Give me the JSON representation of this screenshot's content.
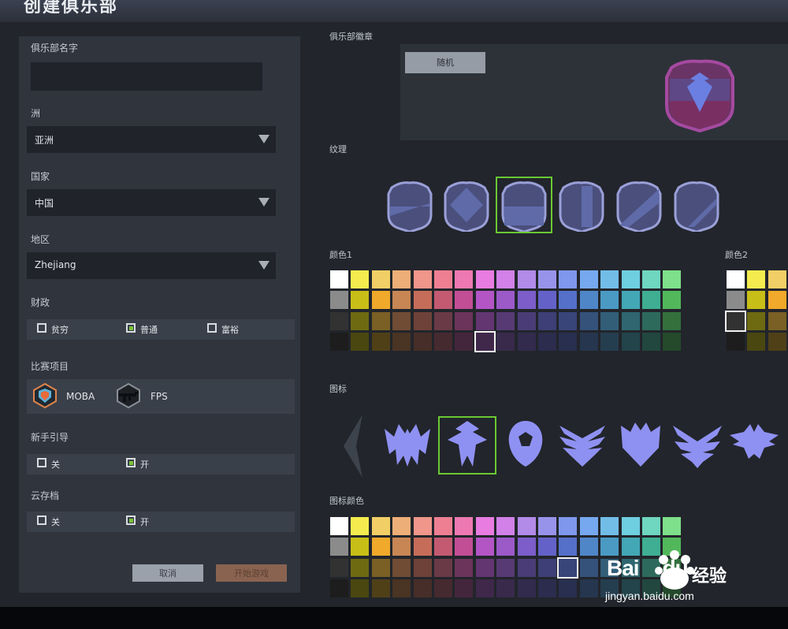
{
  "window": {
    "title": "创建俱乐部"
  },
  "form": {
    "club_name_label": "俱乐部名字",
    "club_name_value": "",
    "continent_label": "洲",
    "continent_value": "亚洲",
    "country_label": "国家",
    "country_value": "中国",
    "region_label": "地区",
    "region_value": "Zhejiang",
    "finance_label": "财政",
    "finance_options": [
      {
        "label": "贫穷",
        "checked": false
      },
      {
        "label": "普通",
        "checked": true
      },
      {
        "label": "富裕",
        "checked": false
      }
    ],
    "events_label": "比赛项目",
    "events": [
      {
        "label": "MOBA",
        "icon": "moba-icon"
      },
      {
        "label": "FPS",
        "icon": "rifle-icon"
      }
    ],
    "tutorial_label": "新手引导",
    "tutorial_options": [
      {
        "label": "关",
        "checked": false
      },
      {
        "label": "开",
        "checked": true
      }
    ],
    "cloud_label": "云存档",
    "cloud_options": [
      {
        "label": "关",
        "checked": false
      },
      {
        "label": "开",
        "checked": true
      }
    ],
    "cancel_label": "取消",
    "start_label": "开始游戏"
  },
  "emblem": {
    "section_label": "俱乐部徽章",
    "random_label": "随机",
    "texture_label": "纹理",
    "color1_label": "颜色1",
    "color2_label": "颜色2",
    "icon_label": "图标",
    "icon_color_label": "图标颜色",
    "selected_texture": 2,
    "selected_icon": 1,
    "palette": [
      [
        "#ffffff",
        "#f4ec4e",
        "#f2cf66",
        "#eeae78",
        "#f0968a",
        "#ee7f92",
        "#ee79b2",
        "#e87ce0",
        "#d181e8",
        "#b28ae8",
        "#9893ea",
        "#7f98ee",
        "#76a8ef",
        "#72bde8",
        "#6ecfe0",
        "#6fd6bf",
        "#7ee08a"
      ],
      [
        "#8b8b8b",
        "#c8be18",
        "#f0a92a",
        "#c88654",
        "#c66d5a",
        "#c35a72",
        "#c24e96",
        "#b455c6",
        "#9c59c8",
        "#7c5dc9",
        "#6462c8",
        "#5570c9",
        "#4f86c8",
        "#4a9ac4",
        "#43a7b5",
        "#3fae93",
        "#52b75b"
      ],
      [
        "#323232",
        "#6e6a12",
        "#7a6024",
        "#704c34",
        "#6e4238",
        "#6a3a46",
        "#6b345a",
        "#633672",
        "#573a74",
        "#4a3c76",
        "#3e3f76",
        "#384578",
        "#34527a",
        "#325e78",
        "#2f6670",
        "#2d6a5c",
        "#33703c"
      ],
      [
        "#1d1d1d",
        "#4a4710",
        "#4f4018",
        "#4a3424",
        "#472e28",
        "#452a30",
        "#44263c",
        "#40284a",
        "#392a4c",
        "#322b4d",
        "#2c2c4e",
        "#282f4f",
        "#26364f",
        "#253e4f",
        "#23444b",
        "#22473f",
        "#24492b"
      ]
    ],
    "color1_selected": {
      "row": 3,
      "col": 7
    },
    "color2_selected": {
      "row": 2,
      "col": 0
    },
    "iconcolor_selected": {
      "row": 2,
      "col": 11
    }
  },
  "watermark": {
    "brand": "Bai",
    "brand2": "du",
    "cn": "经验",
    "url": "jingyan.baidu.com"
  }
}
